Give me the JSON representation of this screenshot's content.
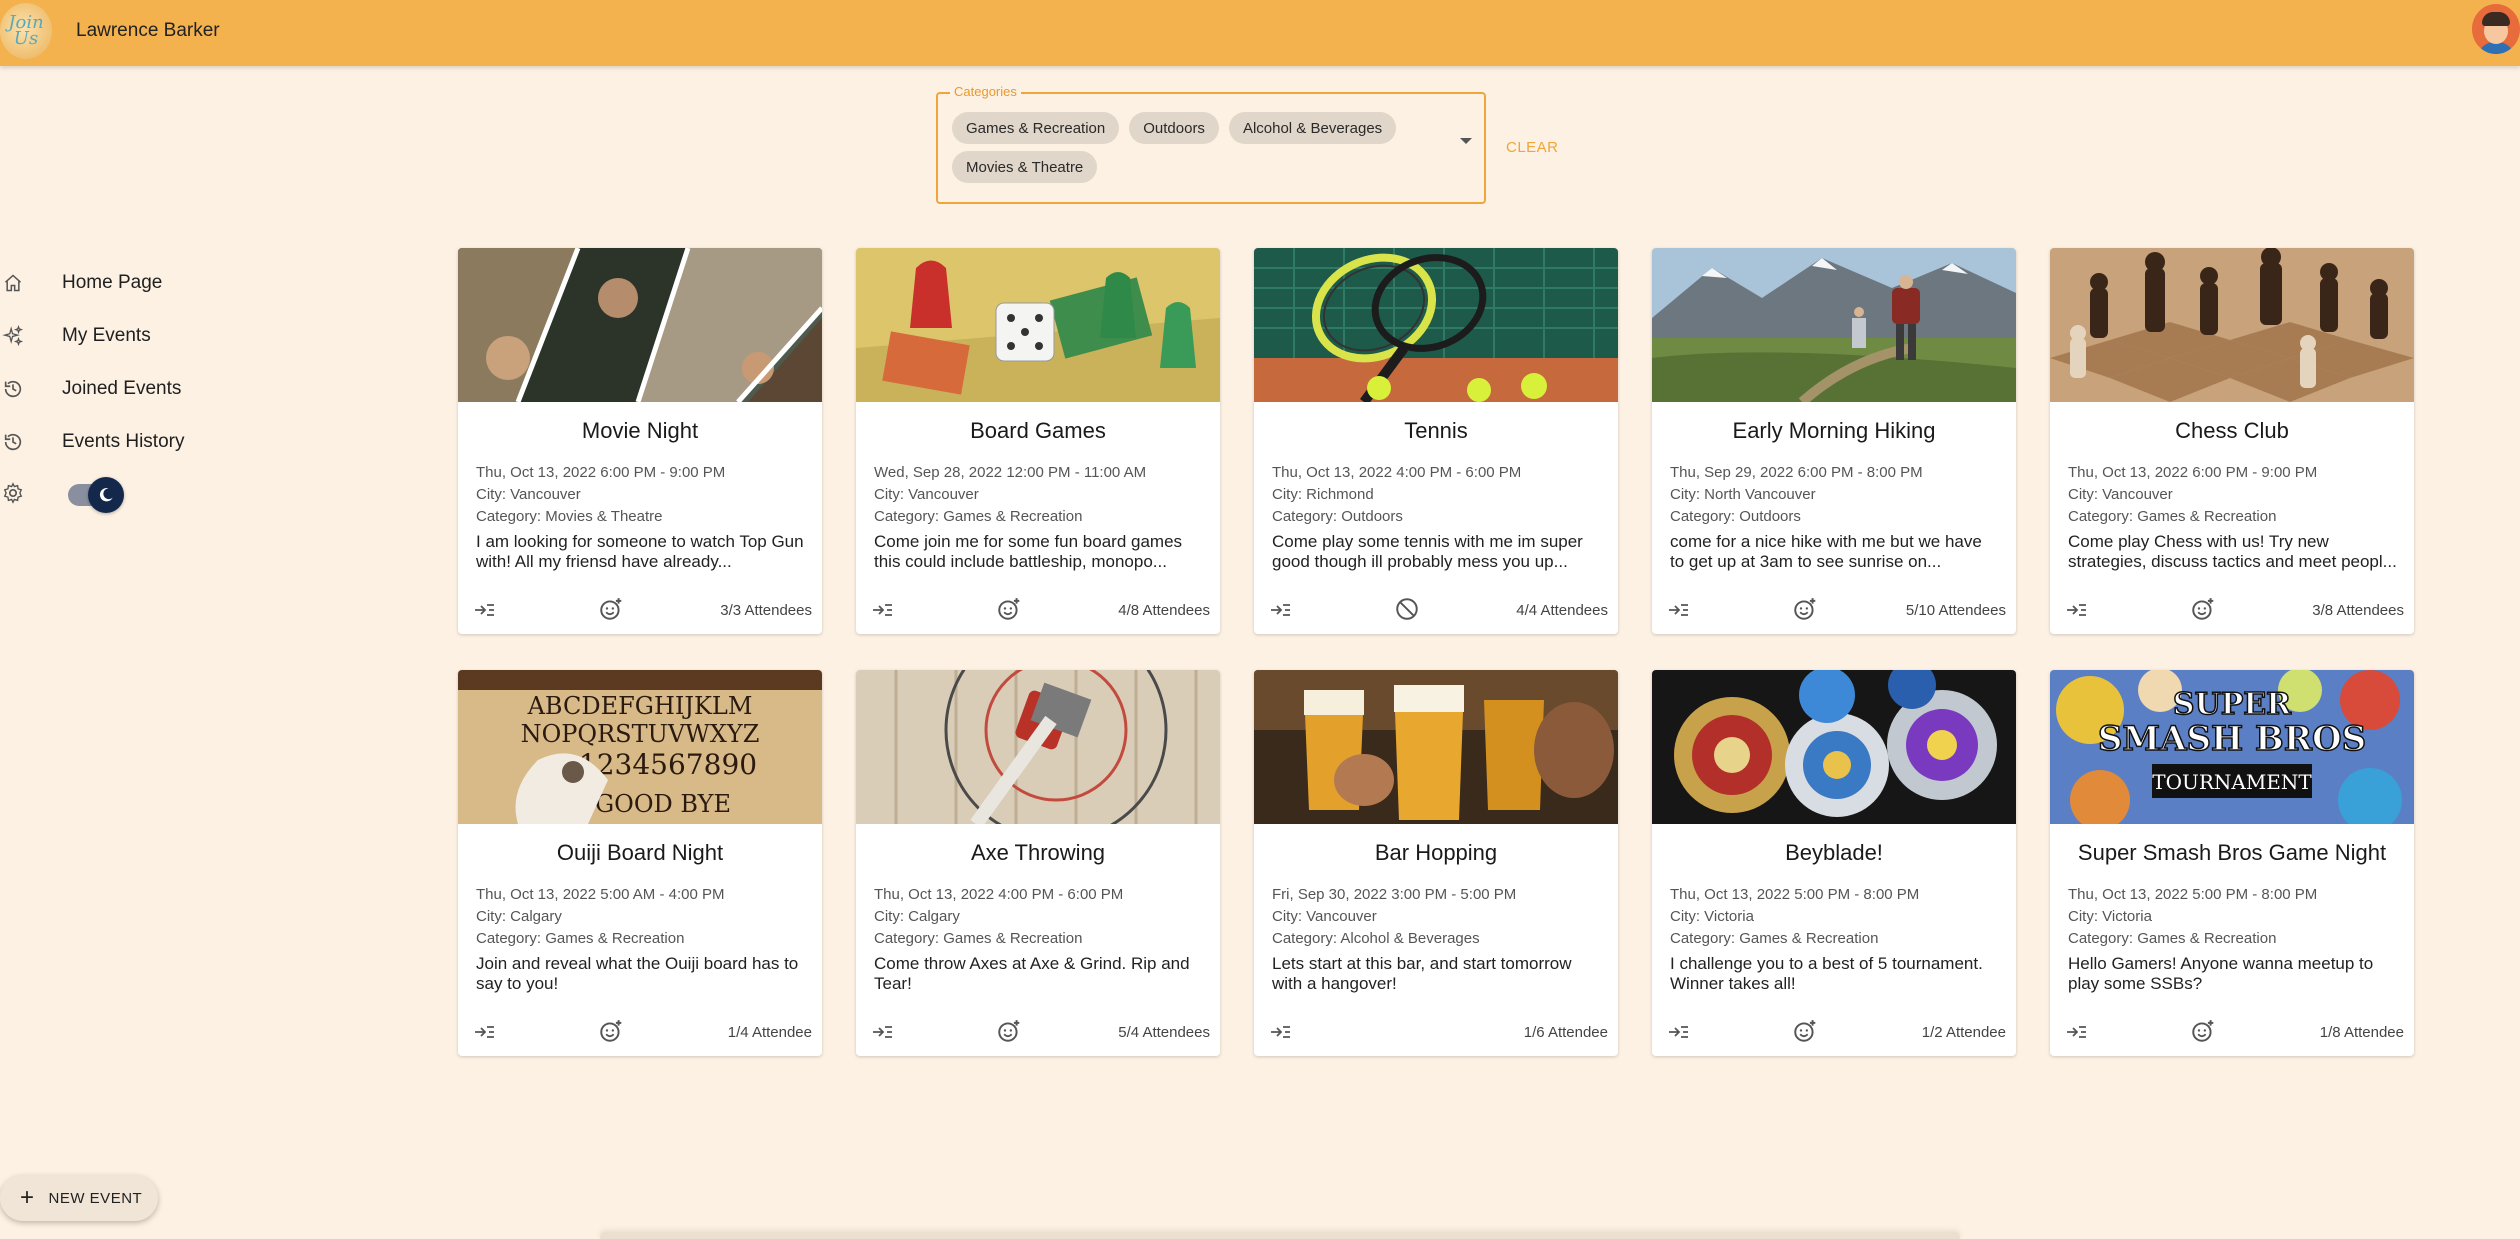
{
  "header": {
    "logo_text": "Join Us",
    "user_name": "Lawrence Barker"
  },
  "filter": {
    "legend": "Categories",
    "chips": [
      "Games & Recreation",
      "Outdoors",
      "Alcohol & Beverages",
      "Movies & Theatre"
    ],
    "clear_label": "CLEAR"
  },
  "sidebar": {
    "items": [
      {
        "label": "Home Page",
        "icon": "home-icon"
      },
      {
        "label": "My Events",
        "icon": "sparkle-icon"
      },
      {
        "label": "Joined Events",
        "icon": "history-icon"
      },
      {
        "label": "Events History",
        "icon": "history-icon"
      }
    ]
  },
  "events": [
    {
      "title": "Movie Night",
      "date": "Thu, Oct 13, 2022 6:00 PM - 9:00 PM",
      "city": "City: Vancouver",
      "category": "Category: Movies & Theatre",
      "desc": "I am looking for someone to watch Top Gun with! All my friensd have already...",
      "attendees": "3/3 Attendees",
      "status_icon": "add-reaction-icon"
    },
    {
      "title": "Board Games",
      "date": "Wed, Sep 28, 2022 12:00 PM - 11:00 AM",
      "city": "City: Vancouver",
      "category": "Category: Games & Recreation",
      "desc": "Come join me for some fun board games this could include battleship, monopo...",
      "attendees": "4/8 Attendees",
      "status_icon": "add-reaction-icon"
    },
    {
      "title": "Tennis",
      "date": "Thu, Oct 13, 2022 4:00 PM - 6:00 PM",
      "city": "City: Richmond",
      "category": "Category: Outdoors",
      "desc": "Come play some tennis with me im super good though ill probably mess you up...",
      "attendees": "4/4 Attendees",
      "status_icon": "block-icon"
    },
    {
      "title": "Early Morning Hiking",
      "date": "Thu, Sep 29, 2022 6:00 PM - 8:00 PM",
      "city": "City: North Vancouver",
      "category": "Category: Outdoors",
      "desc": "come for a nice hike with me but we have to get up at 3am to see sunrise on...",
      "attendees": "5/10 Attendees",
      "status_icon": "add-reaction-icon"
    },
    {
      "title": "Chess Club",
      "date": "Thu, Oct 13, 2022 6:00 PM - 9:00 PM",
      "city": "City: Vancouver",
      "category": "Category: Games & Recreation",
      "desc": "Come play Chess with us! Try new strategies, discuss tactics and meet peopl...",
      "attendees": "3/8 Attendees",
      "status_icon": "add-reaction-icon"
    },
    {
      "title": "Ouiji Board Night",
      "date": "Thu, Oct 13, 2022 5:00 AM - 4:00 PM",
      "city": "City: Calgary",
      "category": "Category: Games & Recreation",
      "desc": "Join and reveal what the Ouiji board has to say to you!",
      "attendees": "1/4 Attendee",
      "status_icon": "add-reaction-icon"
    },
    {
      "title": "Axe Throwing",
      "date": "Thu, Oct 13, 2022 4:00 PM - 6:00 PM",
      "city": "City: Calgary",
      "category": "Category: Games & Recreation",
      "desc": "Come throw Axes at Axe & Grind. Rip and Tear!",
      "attendees": "5/4 Attendees",
      "status_icon": "add-reaction-icon"
    },
    {
      "title": "Bar Hopping",
      "date": "Fri, Sep 30, 2022 3:00 PM - 5:00 PM",
      "city": "City: Vancouver",
      "category": "Category: Alcohol & Beverages",
      "desc": "Lets start at this bar, and start tomorrow with a hangover!",
      "attendees": "1/6 Attendee",
      "status_icon": "none"
    },
    {
      "title": "Beyblade!",
      "date": "Thu, Oct 13, 2022 5:00 PM - 8:00 PM",
      "city": "City: Victoria",
      "category": "Category: Games & Recreation",
      "desc": "I challenge you to a best of 5 tournament. Winner takes all!",
      "attendees": "1/2 Attendee",
      "status_icon": "add-reaction-icon"
    },
    {
      "title": "Super Smash Bros Game Night",
      "date": "Thu, Oct 13, 2022 5:00 PM - 8:00 PM",
      "city": "City: Victoria",
      "category": "Category: Games & Recreation",
      "desc": "Hello Gamers! Anyone wanna meetup to play some SSBs?",
      "attendees": "1/8 Attendee",
      "status_icon": "add-reaction-icon"
    }
  ],
  "image_text": {
    "ouija": "ABCDEFGHIJKLM NOPQRSTUVWXYZ 1234567890 GOOD BYE",
    "smash_line1": "SUPER",
    "smash_line2": "SMASH BROS",
    "smash_line3": "TOURNAMENT"
  },
  "new_event_label": "NEW EVENT",
  "colors": {
    "header": "#f4b24f",
    "background": "#fcf1e3",
    "accent": "#f0a53a",
    "toggle_knob": "#13284b"
  }
}
